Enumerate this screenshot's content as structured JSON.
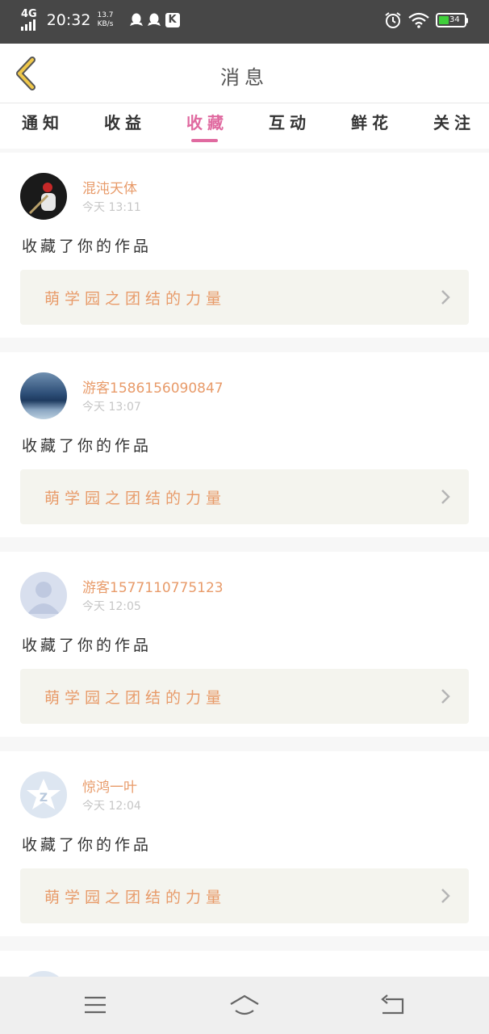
{
  "status_bar": {
    "network": "4G",
    "time": "20:32",
    "speed_value": "13.7",
    "speed_unit": "KB/s",
    "battery_level": "34",
    "icons": [
      "signal-icon",
      "qq-icon",
      "qq-icon",
      "k-app-icon",
      "alarm-icon",
      "wifi-icon",
      "battery-icon"
    ],
    "battery_color": "#3fcf3a"
  },
  "header": {
    "title": "消息",
    "back_icon": "chevron-left-icon"
  },
  "tabs": {
    "items": [
      "通知",
      "收益",
      "收藏",
      "互动",
      "鲜花",
      "关注"
    ],
    "active_index": 2,
    "accent": "#e06aa0"
  },
  "messages": [
    {
      "username": "混沌天体",
      "time": "今天 13:11",
      "action": "收藏了你的作品",
      "work_title": "萌学园之团结的力量",
      "avatar": "photo-avatar"
    },
    {
      "username": "游客15861560908​47",
      "time": "今天 13:07",
      "action": "收藏了你的作品",
      "work_title": "萌学园之团结的力量",
      "avatar": "sea-avatar"
    },
    {
      "username": "游客15771107751​23",
      "time": "今天 12:05",
      "action": "收藏了你的作品",
      "work_title": "萌学园之团结的力量",
      "avatar": "default-avatar"
    },
    {
      "username": "惊鸿一叶",
      "time": "今天 12:04",
      "action": "收藏了你的作品",
      "work_title": "萌学园之团结的力量",
      "avatar": "qzone-avatar"
    }
  ],
  "colors": {
    "username": "#e89b6a",
    "work_bg": "#f4f4ee"
  },
  "nav": {
    "icons": [
      "menu-icon",
      "home-icon",
      "back-icon"
    ]
  }
}
